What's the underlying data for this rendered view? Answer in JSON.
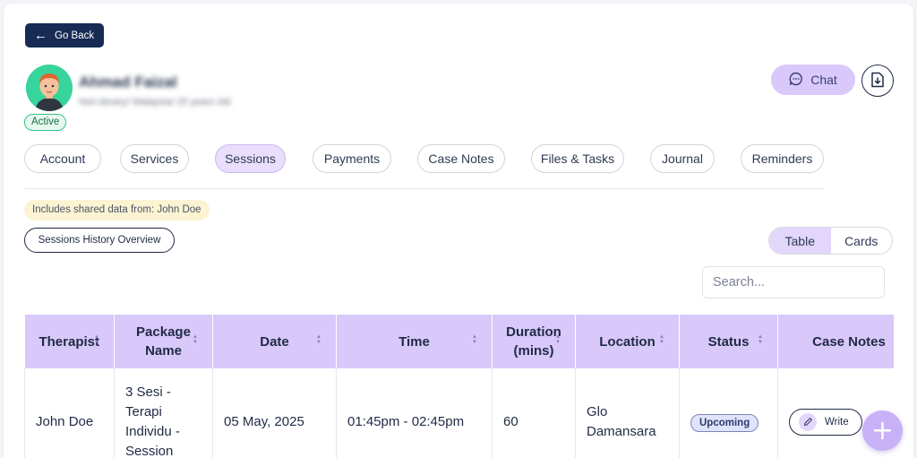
{
  "header": {
    "go_back_label": "Go Back",
    "chat_label": "Chat"
  },
  "client": {
    "name": "Ahmad Faizal",
    "details": "Non-binary/ Malaysia/ 25 years old",
    "status": "Active"
  },
  "tabs": [
    {
      "label": "Account"
    },
    {
      "label": "Services"
    },
    {
      "label": "Sessions",
      "active": true
    },
    {
      "label": "Payments"
    },
    {
      "label": "Case Notes"
    },
    {
      "label": "Files & Tasks"
    },
    {
      "label": "Journal"
    },
    {
      "label": "Reminders"
    }
  ],
  "sessions": {
    "shared_note": "Includes shared data from: John Doe",
    "history_button": "Sessions History Overview",
    "view_options": [
      "Table",
      "Cards"
    ],
    "active_view": "Table",
    "search_placeholder": "Search...",
    "columns": [
      "Therapist",
      "Package Name",
      "Date",
      "Time",
      "Duration (mins)",
      "Location",
      "Status",
      "Case Notes"
    ],
    "rows": [
      {
        "therapist": "John Doe",
        "package": "3 Sesi - Terapi Individu - Session",
        "date": "05 May, 2025",
        "time": "01:45pm - 02:45pm",
        "duration": "60",
        "location": "Glo Damansara",
        "status": "Upcoming",
        "case_notes_action": "Write"
      }
    ]
  },
  "colors": {
    "primary_dark": "#172b55",
    "accent_lavender": "#d9c8fa",
    "active_green": "#34c28a",
    "note_yellow": "#fcf3d2"
  },
  "icons": {
    "back": "arrow-left-icon",
    "chat": "chat-bubble-icon",
    "download": "file-download-icon",
    "write": "pencil-icon",
    "add": "plus-icon"
  }
}
